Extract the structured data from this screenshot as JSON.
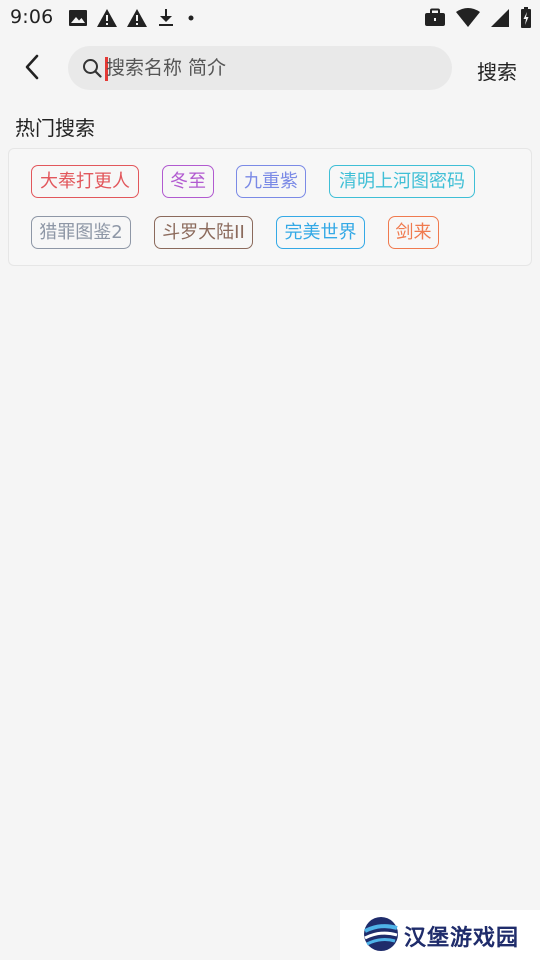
{
  "status_bar": {
    "time": "9:06",
    "left_icons": [
      "image-icon",
      "warning-icon",
      "warning-icon",
      "download-icon",
      "dot-icon"
    ],
    "right_icons": [
      "briefcase-icon",
      "wifi-icon",
      "signal-icon",
      "battery-icon"
    ]
  },
  "top_bar": {
    "back_icon": "chevron-left-icon",
    "search_placeholder": "搜索名称 简介",
    "search_value": "",
    "search_button_label": "搜索"
  },
  "hot_search": {
    "title": "热门搜索",
    "tags": [
      {
        "label": "大奉打更人",
        "color": "#e2575c"
      },
      {
        "label": "冬至",
        "color": "#b15ad0"
      },
      {
        "label": "九重紫",
        "color": "#7b8ae6"
      },
      {
        "label": "清明上河图密码",
        "color": "#3fbfd6"
      },
      {
        "label": "猎罪图鉴2",
        "color": "#8e97a6"
      },
      {
        "label": "斗罗大陆II",
        "color": "#8b6a5c"
      },
      {
        "label": "完美世界",
        "color": "#34a9e6"
      },
      {
        "label": "剑来",
        "color": "#f07a4e"
      }
    ]
  },
  "watermark": {
    "text": "汉堡游戏园"
  }
}
